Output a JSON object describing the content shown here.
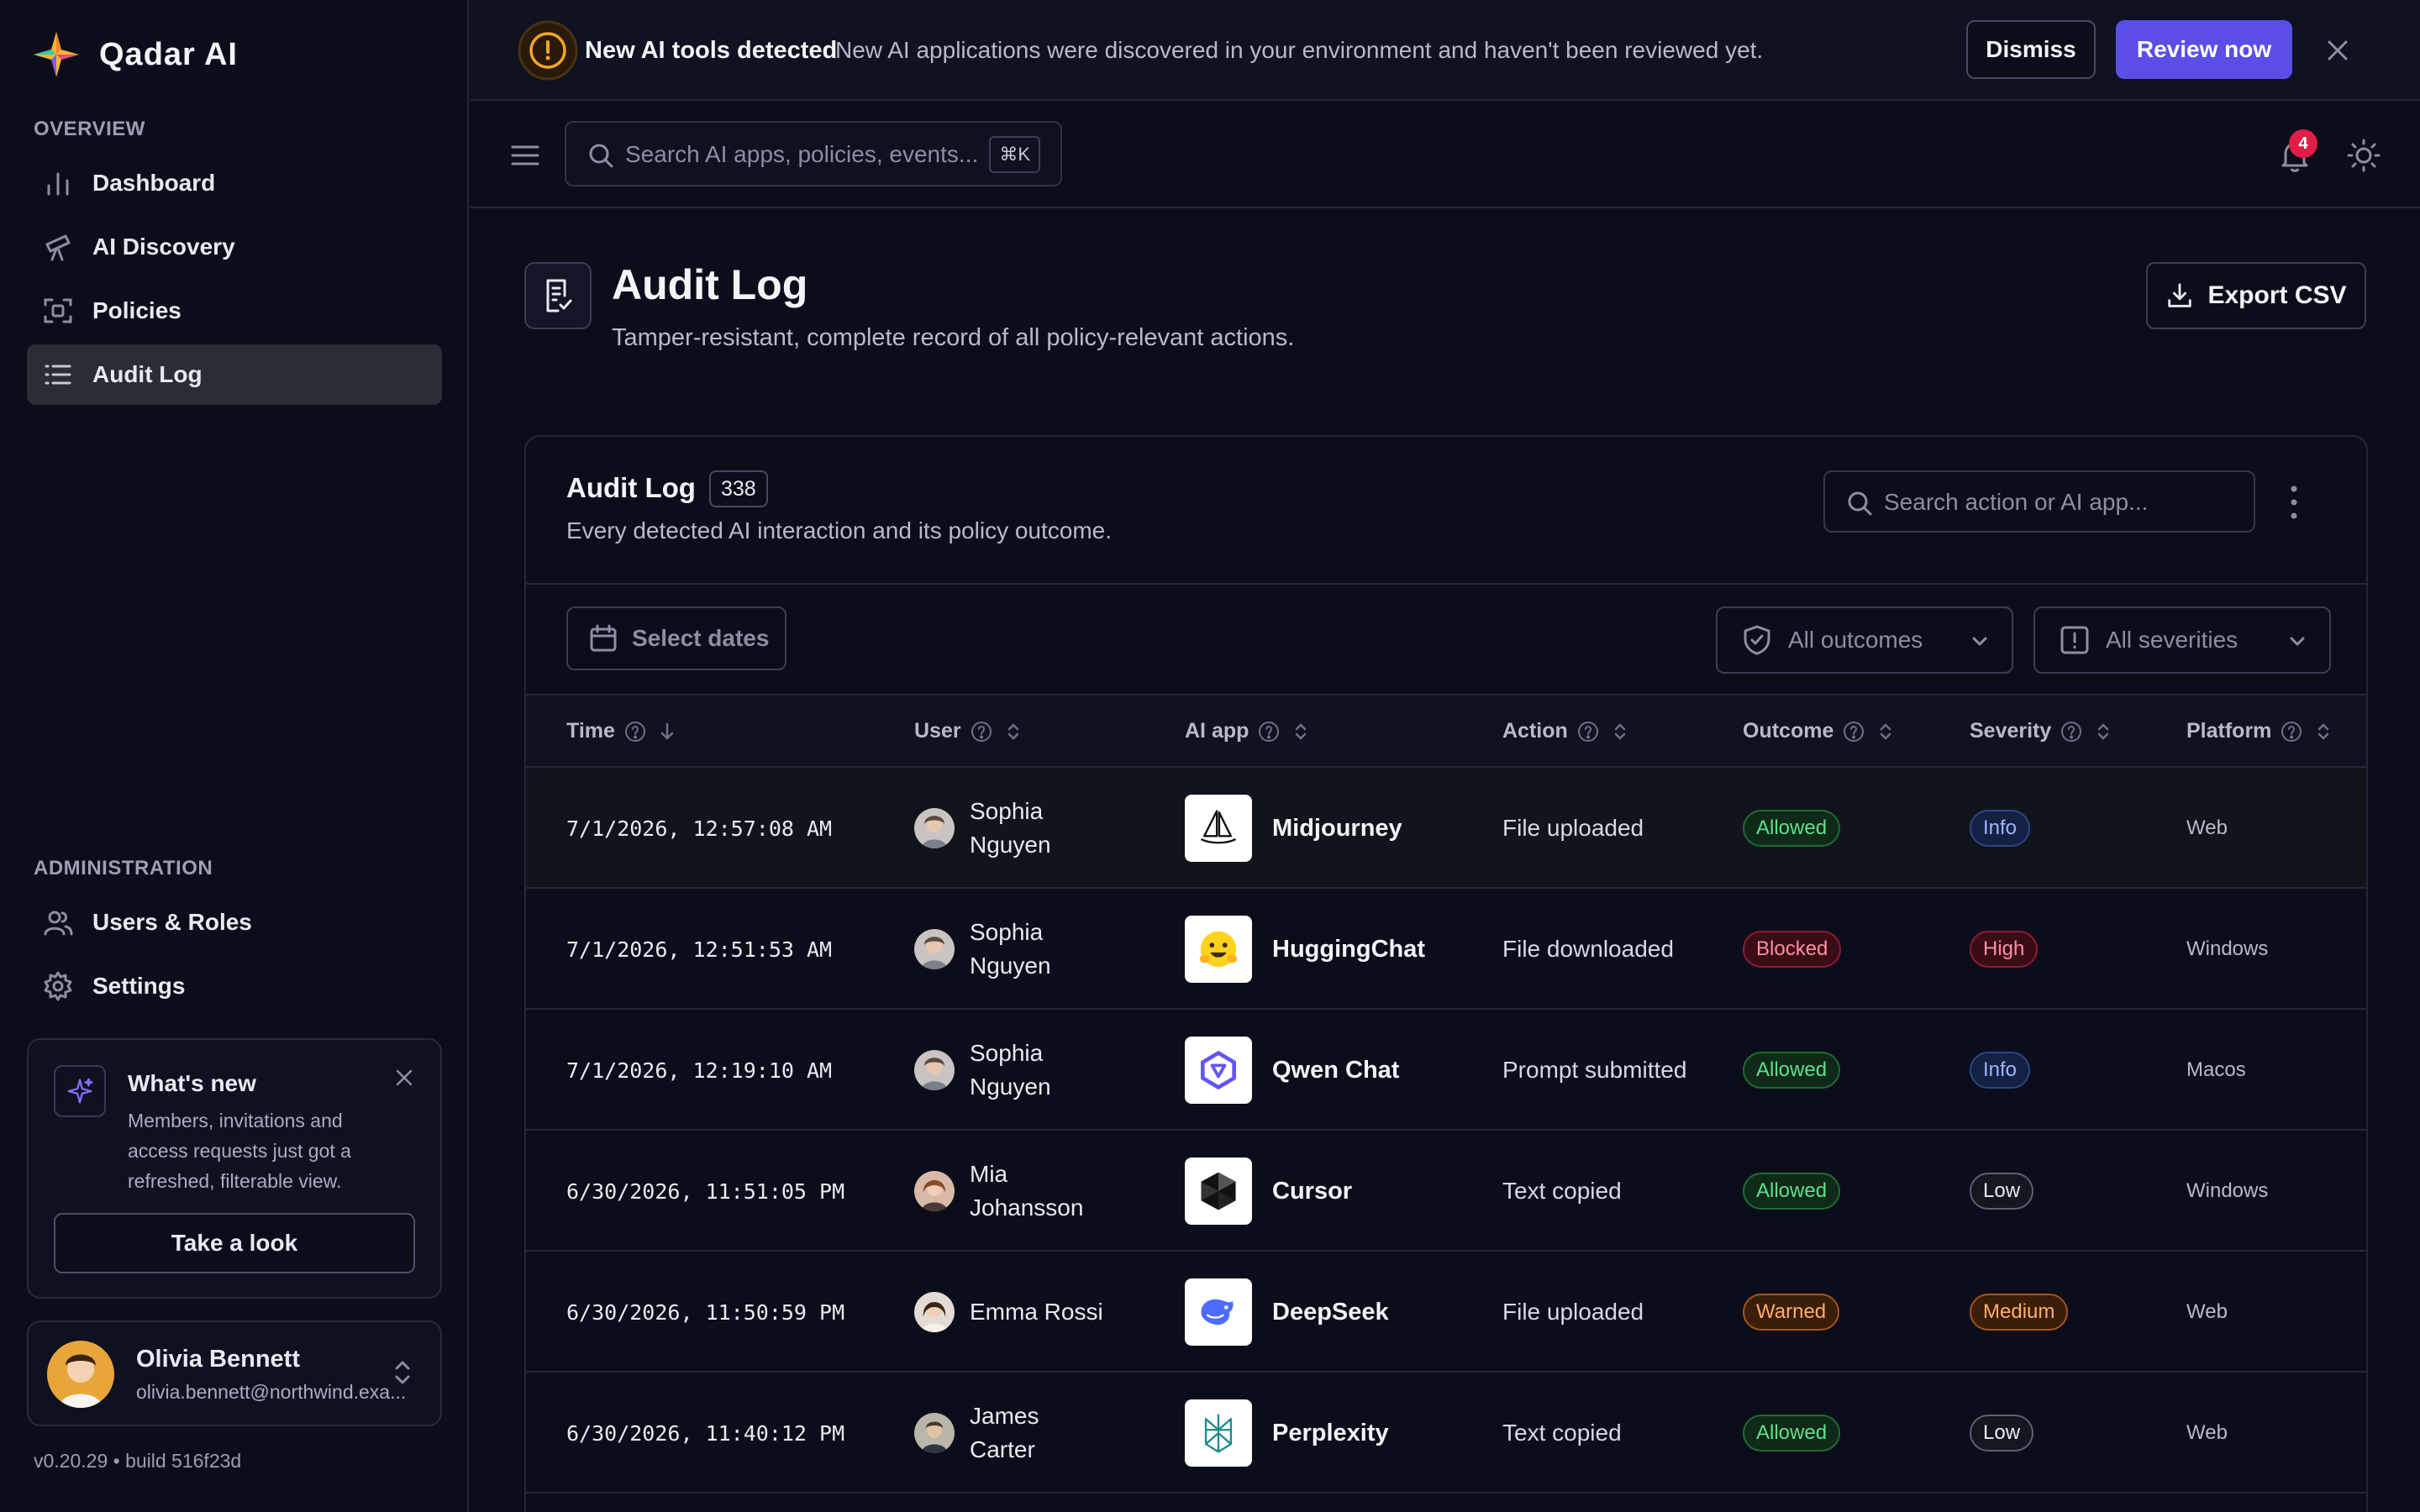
{
  "brand": {
    "name": "Qadar AI"
  },
  "sidebar": {
    "overview_label": "OVERVIEW",
    "overview_items": [
      {
        "label": "Dashboard",
        "icon": "bar-chart-icon"
      },
      {
        "label": "AI Discovery",
        "icon": "telescope-icon"
      },
      {
        "label": "Policies",
        "icon": "policy-frame-icon"
      },
      {
        "label": "Audit Log",
        "icon": "list-icon",
        "active": true
      }
    ],
    "admin_label": "ADMINISTRATION",
    "admin_items": [
      {
        "label": "Users & Roles",
        "icon": "users-icon"
      },
      {
        "label": "Settings",
        "icon": "gear-icon"
      }
    ],
    "whats_new": {
      "title": "What's new",
      "text": "Members, invitations and access requests just got a refreshed, filterable view.",
      "button": "Take a look"
    },
    "user": {
      "name": "Olivia Bennett",
      "email": "olivia.bennett@northwind.exa..."
    },
    "version": "v0.20.29 • build 516f23d"
  },
  "banner": {
    "title": "New AI tools detected",
    "text": "New AI applications were discovered in your environment and haven't been reviewed yet.",
    "dismiss": "Dismiss",
    "review": "Review now"
  },
  "topbar": {
    "search_placeholder": "Search AI apps, policies, events...",
    "shortcut": "⌘K",
    "notification_count": "4"
  },
  "page": {
    "title": "Audit Log",
    "subtitle": "Tamper-resistant, complete record of all policy-relevant actions.",
    "export": "Export CSV"
  },
  "card": {
    "title": "Audit Log",
    "count": "338",
    "subtitle": "Every detected AI interaction and its policy outcome.",
    "search_placeholder": "Search action or AI app...",
    "dates_button": "Select dates",
    "outcome_filter": "All outcomes",
    "severity_filter": "All severities"
  },
  "table": {
    "columns": [
      "Time",
      "User",
      "AI app",
      "Action",
      "Outcome",
      "Severity",
      "Platform"
    ],
    "rows": [
      {
        "time": "7/1/2026, 12:57:08 AM",
        "user": "Sophia Nguyen",
        "app": "Midjourney",
        "action": "File uploaded",
        "outcome": "Allowed",
        "severity": "Info",
        "platform": "Web"
      },
      {
        "time": "7/1/2026, 12:51:53 AM",
        "user": "Sophia Nguyen",
        "app": "HuggingChat",
        "action": "File downloaded",
        "outcome": "Blocked",
        "severity": "High",
        "platform": "Windows"
      },
      {
        "time": "7/1/2026, 12:19:10 AM",
        "user": "Sophia Nguyen",
        "app": "Qwen Chat",
        "action": "Prompt submitted",
        "outcome": "Allowed",
        "severity": "Info",
        "platform": "Macos"
      },
      {
        "time": "6/30/2026, 11:51:05 PM",
        "user": "Mia Johansson",
        "app": "Cursor",
        "action": "Text copied",
        "outcome": "Allowed",
        "severity": "Low",
        "platform": "Windows"
      },
      {
        "time": "6/30/2026, 11:50:59 PM",
        "user": "Emma Rossi",
        "app": "DeepSeek",
        "action": "File uploaded",
        "outcome": "Warned",
        "severity": "Medium",
        "platform": "Web"
      },
      {
        "time": "6/30/2026, 11:40:12 PM",
        "user": "James Carter",
        "app": "Perplexity",
        "action": "Text copied",
        "outcome": "Allowed",
        "severity": "Low",
        "platform": "Web"
      }
    ]
  },
  "colors": {
    "accent": "#5a4ee6",
    "background": "#0b0e1a",
    "allowed": "#5fe08a",
    "blocked": "#ff8ea0",
    "warned": "#ffae6b",
    "info": "#9db7ff"
  }
}
